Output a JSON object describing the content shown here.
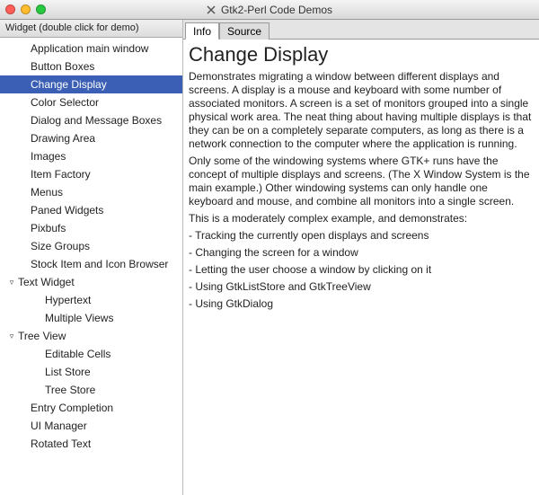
{
  "window": {
    "title": "Gtk2-Perl Code Demos",
    "traffic": {
      "close": "close",
      "min": "minimize",
      "zoom": "zoom"
    }
  },
  "sidebar": {
    "header": "Widget (double click for demo)",
    "items": [
      {
        "label": "Application main window",
        "depth": 1
      },
      {
        "label": "Button Boxes",
        "depth": 1
      },
      {
        "label": "Change Display",
        "depth": 1,
        "selected": true
      },
      {
        "label": "Color Selector",
        "depth": 1
      },
      {
        "label": "Dialog and Message Boxes",
        "depth": 1
      },
      {
        "label": "Drawing Area",
        "depth": 1
      },
      {
        "label": "Images",
        "depth": 1
      },
      {
        "label": "Item Factory",
        "depth": 1
      },
      {
        "label": "Menus",
        "depth": 1
      },
      {
        "label": "Paned Widgets",
        "depth": 1
      },
      {
        "label": "Pixbufs",
        "depth": 1
      },
      {
        "label": "Size Groups",
        "depth": 1
      },
      {
        "label": "Stock Item and Icon Browser",
        "depth": 1
      },
      {
        "label": "Text Widget",
        "depth": 0,
        "expander": "▿"
      },
      {
        "label": "Hypertext",
        "depth": 2
      },
      {
        "label": "Multiple Views",
        "depth": 2
      },
      {
        "label": "Tree View",
        "depth": 0,
        "expander": "▿"
      },
      {
        "label": "Editable Cells",
        "depth": 2
      },
      {
        "label": "List Store",
        "depth": 2
      },
      {
        "label": "Tree Store",
        "depth": 2
      },
      {
        "label": "Entry Completion",
        "depth": 1
      },
      {
        "label": "UI Manager",
        "depth": 1
      },
      {
        "label": "Rotated Text",
        "depth": 1
      }
    ]
  },
  "tabs": {
    "info": "Info",
    "source": "Source"
  },
  "info": {
    "heading": "Change Display",
    "p1": "Demonstrates migrating a window between different displays and screens. A display is a mouse and keyboard with some number of associated monitors. A screen is a set of monitors grouped into a single physical work area. The neat thing about having multiple displays is that they can be on a completely separate computers, as long as there is a network connection to the computer where the application is running.",
    "p2": "Only some of the windowing systems where GTK+ runs have the concept of multiple displays and screens. (The X Window System is the main example.) Other windowing systems can only handle one keyboard and mouse, and combine all monitors into a single screen.",
    "p3": "This is a moderately complex example, and demonstrates:",
    "b1": "- Tracking the currently open displays and screens",
    "b2": "- Changing the screen for a window",
    "b3": "- Letting the user choose a window by clicking on it",
    "b4": "- Using GtkListStore and GtkTreeView",
    "b5": "- Using GtkDialog"
  }
}
